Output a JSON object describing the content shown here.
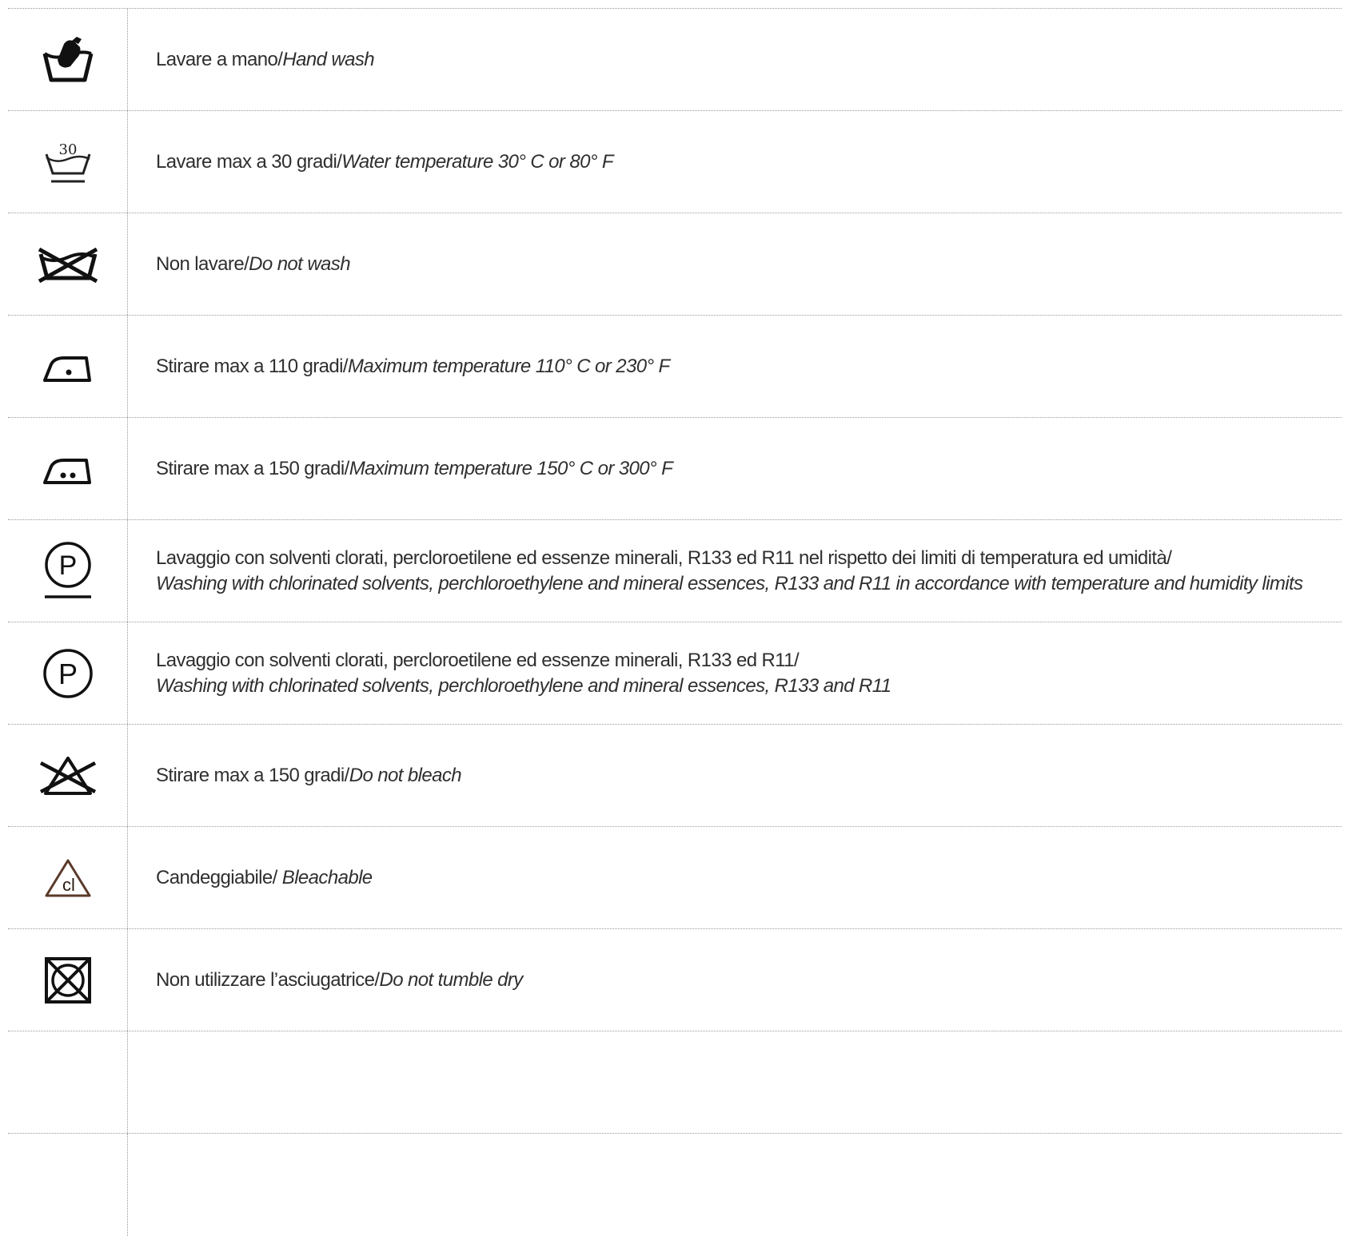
{
  "rows": [
    {
      "icon": "hand-wash-icon",
      "it": "Lavare a mano/",
      "en": "Hand wash"
    },
    {
      "icon": "wash-30-icon",
      "icon_label": "30",
      "it": "Lavare max a 30 gradi/",
      "en": "Water temperature 30° C or 80° F"
    },
    {
      "icon": "do-not-wash-icon",
      "it": "Non lavare/",
      "en": "Do not wash"
    },
    {
      "icon": "iron-one-dot-icon",
      "it": "Stirare max a 110 gradi/",
      "en": "Maximum temperature 110° C or 230° F"
    },
    {
      "icon": "iron-two-dots-icon",
      "it": "Stirare max a 150 gradi/",
      "en": "Maximum temperature 150° C or 300° F"
    },
    {
      "icon": "dry-clean-p-underline-icon",
      "icon_label": "P",
      "it": "Lavaggio con solventi clorati, percloroetilene ed essenze minerali, R133 ed R11 nel rispetto dei limiti di temperatura ed umidità/",
      "en": "Washing with chlorinated solvents, perchloroethylene and mineral essences, R133 and R11 in accordance with temperature and humidity limits"
    },
    {
      "icon": "dry-clean-p-icon",
      "icon_label": "P",
      "it": "Lavaggio con solventi clorati, percloroetilene ed essenze minerali, R133 ed R11/",
      "en": "Washing with chlorinated solvents, perchloroethylene and mineral essences, R133 and R11"
    },
    {
      "icon": "do-not-bleach-icon",
      "it": "Stirare max a 150 gradi/",
      "en": "Do not bleach"
    },
    {
      "icon": "bleach-cl-icon",
      "icon_label": "cl",
      "it": "Candeggiabile/ ",
      "en": "Bleachable"
    },
    {
      "icon": "do-not-tumble-dry-icon",
      "it": "Non utilizzare l’asciugatrice/",
      "en": "Do not tumble dry"
    }
  ]
}
